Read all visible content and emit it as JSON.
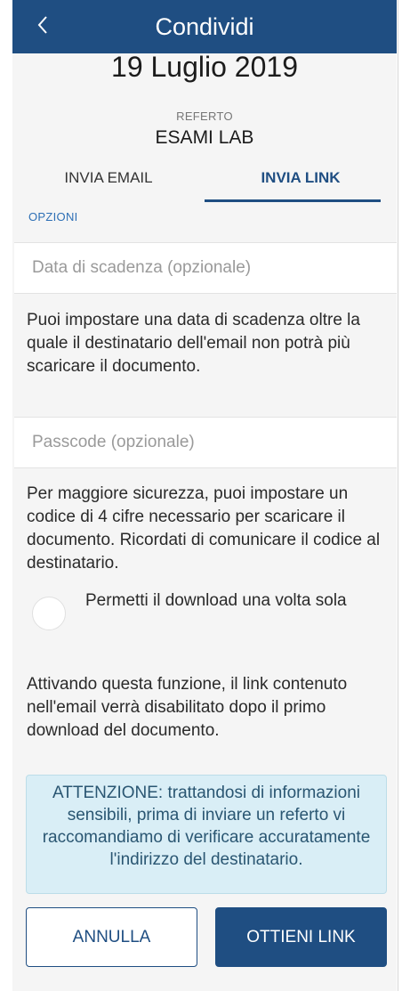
{
  "header": {
    "title": "Condividi",
    "back_icon": "chevron-left-icon"
  },
  "document": {
    "date": "19 Luglio 2019",
    "type_label": "REFERTO",
    "title": "ESAMI LAB"
  },
  "tabs": [
    {
      "label": "INVIA EMAIL",
      "active": false
    },
    {
      "label": "INVIA LINK",
      "active": true
    }
  ],
  "options": {
    "section_label": "OPZIONI",
    "expiry": {
      "placeholder": "Data di scadenza (opzionale)",
      "value": "",
      "help": "Puoi impostare una data di scadenza oltre la quale il destinatario dell'email non potrà più scaricare il documento."
    },
    "passcode": {
      "placeholder": "Passcode (opzionale)",
      "value": "",
      "help": "Per maggiore sicurezza, puoi impostare un codice di 4 cifre necessario per scaricare il documento. Ricordati di comunicare il codice al destinatario."
    },
    "single_download": {
      "label": "Permetti il download una volta sola",
      "checked": false,
      "help": "Attivando questa funzione, il link contenuto nell'email verrà disabilitato dopo il primo download del documento."
    }
  },
  "alert": {
    "text": "ATTENZIONE: trattandosi di informazioni sensibili, prima di inviare un referto vi raccomandiamo di verificare accuratamente l'indirizzo del destinatario."
  },
  "actions": {
    "cancel_label": "ANNULLA",
    "get_link_label": "OTTIENI LINK"
  },
  "colors": {
    "primary": "#1f4e82",
    "link_blue": "#2d6fb5",
    "alert_bg": "#d9eef6",
    "page_bg": "#f5f5f5"
  }
}
